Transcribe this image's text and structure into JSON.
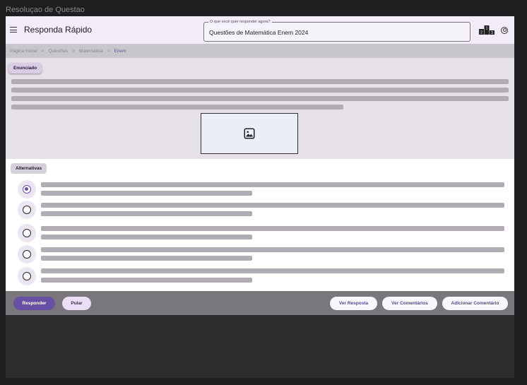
{
  "window": {
    "title": "Resoluçao de Questao"
  },
  "appbar": {
    "menu_icon": "menu-icon",
    "title": "Responda Rápido",
    "search": {
      "label": "O que você quer responder agora?",
      "value": "Questões de Matemática Enem 2024"
    },
    "ranking_icon": "podium-icon",
    "podium_numbers": [
      "2",
      "1",
      "3"
    ],
    "account_icon": "account-circle-icon"
  },
  "breadcrumb": {
    "items": [
      "Página Inicial",
      "Questões",
      "Matemática",
      "Enem"
    ],
    "separator": ">"
  },
  "statement": {
    "chip_label": "Enunciado",
    "image_icon": "image-icon"
  },
  "alternatives": {
    "chip_label": "Alternativas",
    "options": [
      {
        "selected": true
      },
      {
        "selected": false
      },
      {
        "selected": false
      },
      {
        "selected": false
      },
      {
        "selected": false
      }
    ]
  },
  "actions": {
    "respond": "Responder",
    "skip": "Pular",
    "view_answer": "Ver Resposta",
    "view_comments": "Ver Comentários",
    "add_comment": "Adicionar Comentário"
  },
  "colors": {
    "primary": "#6750a4",
    "appbar_bg": "#f2ecf8",
    "statement_bg": "#e6e0e8",
    "placeholder_bar": "#b1acb4",
    "action_bar_bg": "#7a777c"
  }
}
